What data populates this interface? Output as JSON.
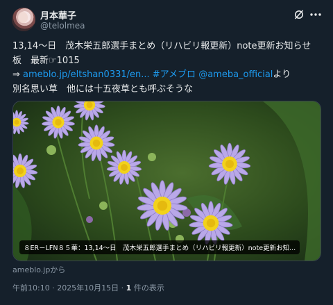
{
  "author": {
    "display_name": "月本華子",
    "handle": "@telolmea"
  },
  "tweet": {
    "line1": "13,14〜日　茂木栄五郎選手まとめ（リハビリ報更新）note更新お知らせ",
    "line2": "板　最新☞1015",
    "arrow": "⇒ ",
    "url": "ameblo.jp/eltshan0331/en...",
    "hashtag": "#アメブロ",
    "mention": "@ameba_official",
    "suffix": "より",
    "line4": "別名思い草　他には十五夜草とも呼ぶそうな"
  },
  "card": {
    "caption": "８ER－LFN８５華：13,14〜日　茂木栄五郎選手まとめ（リハビリ報更新）note更新お知...",
    "source": "ameblo.jpから"
  },
  "meta": {
    "time": "午前10:10 · 2025年10月15日 · ",
    "views_count": "1",
    "views_label": " 件の表示"
  },
  "colors": {
    "background": "#15202b",
    "link": "#1d9bf0",
    "secondary_text": "#8b98a5",
    "flower_petal": "#b7a6e6",
    "flower_center": "#f2d21b"
  },
  "icons": [
    "grok-icon",
    "more-icon"
  ]
}
